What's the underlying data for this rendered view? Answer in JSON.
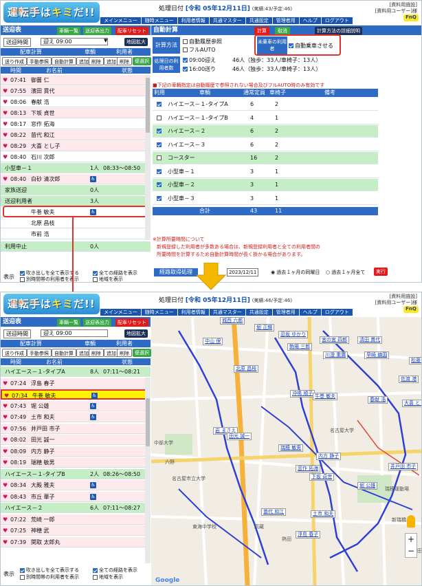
{
  "app": {
    "logo_small": "送迎表システム",
    "logo_text_a": "運転手は",
    "logo_text_b": "キミ",
    "logo_text_c": "だ!!",
    "logo_text_d": "クラウド",
    "org_line1": "[資料用施設]",
    "org_line2": "[資料用ユーザー]様",
    "fnq": "FnQ"
  },
  "menu": [
    "メインメニュー",
    "随時メニュー",
    "利用者情報",
    "共通マスター",
    "共通設定",
    "管理者用",
    "ヘルプ",
    "ログアウト"
  ],
  "shot1": {
    "date_label": "処理日付",
    "date_value": "[令和 05年12月11日]",
    "counts": "(実績:43/予定:46)",
    "panel_title": "送迎表",
    "btn_list": "車輌一覧",
    "btn_output": "送迎表出力",
    "btn_reset": "配車リセット",
    "time_label": "送迎時間",
    "time_value": "迎え 09:00",
    "map_btn": "地図拡大",
    "hdr_info": "配車計算",
    "hdr_car": "車輌",
    "hdr_user": "利用者",
    "btn_make": "送り作成",
    "btn_manual": "手動参照",
    "btn_auto": "自動計算",
    "btn_add": "追加",
    "btn_del": "削除",
    "btn_add2": "追加",
    "btn_del2": "削除",
    "btn_toilet": "便選択",
    "col_time": "時間",
    "col_name": "お名前",
    "col_status": "状態",
    "rows": [
      {
        "time": "07:41",
        "name": "御薗 仁"
      },
      {
        "time": "07:55",
        "name": "濱田 貫代"
      },
      {
        "time": "08:06",
        "name": "春献 浩"
      },
      {
        "time": "08:13",
        "name": "下坂 貞世"
      },
      {
        "time": "08:17",
        "name": "窓作 拓海"
      },
      {
        "time": "08:22",
        "name": "苗代 和江"
      },
      {
        "time": "08:29",
        "name": "大喜 とし子"
      },
      {
        "time": "08:40",
        "name": "石川 次郎"
      }
    ],
    "car_row": {
      "name": "小型車－１",
      "count": "1人",
      "time": "08:33〜08:50"
    },
    "car_row_user": {
      "time": "08:40",
      "name": "白砂 清次郎"
    },
    "family_row": {
      "name": "家族送迎",
      "count": "0人"
    },
    "users_row": {
      "name": "送迎利用者",
      "count": "3人"
    },
    "users": [
      "牛巻 敏夫",
      "北原 昌枝",
      "市前 浩"
    ],
    "stop_row": {
      "name": "利用中止",
      "count": "0人"
    },
    "display_label": "表示",
    "opt_blowout": "吹き出しを全て表示する",
    "opt_route": "全ての経路を表示",
    "opt_other": "別時間帯の利用者を表示",
    "opt_area": "地域を表示",
    "auto_title": "自動計算",
    "btn_calc": "計算",
    "btn_cancel": "取消",
    "btn_detail": "計算方法の詳細説明",
    "calc_method": "計算方法",
    "opt_history": "自動履歴参照",
    "opt_fullauto": "フルAUTO",
    "unassigned_label": "未乗車の利用者",
    "opt_autoboard": "自動乗車させる",
    "proc_day_label": "処理日の利用者数",
    "day_row1": {
      "label": "09:00迎え",
      "value": "46人（独歩：33人/車椅子：13人）"
    },
    "day_row2": {
      "label": "16:00送り",
      "value": "46人（独歩：33人/車椅子：13人）"
    },
    "note": "■下記の車輌指定は自動履歴で参照されない場合及びフルAUTO時のみ有効です",
    "tbl_use": "利用",
    "tbl_car": "車輌",
    "tbl_cap": "通常定員",
    "tbl_wheel": "車椅子",
    "tbl_note": "備考",
    "vehicles": [
      {
        "name": "ハイエース－１-タイプA",
        "cap": "6",
        "wheel": "2",
        "on": true,
        "green": false
      },
      {
        "name": "ハイエース－１-タイプB",
        "cap": "4",
        "wheel": "1",
        "on": false,
        "green": false
      },
      {
        "name": "ハイエース－２",
        "cap": "6",
        "wheel": "2",
        "on": true,
        "green": true
      },
      {
        "name": "ハイエース－３",
        "cap": "6",
        "wheel": "2",
        "on": true,
        "green": false
      },
      {
        "name": "コースター",
        "cap": "16",
        "wheel": "2",
        "on": false,
        "green": true
      },
      {
        "name": "小型車－１",
        "cap": "3",
        "wheel": "1",
        "on": true,
        "green": false
      },
      {
        "name": "小型車－２",
        "cap": "3",
        "wheel": "1",
        "on": true,
        "green": true
      },
      {
        "name": "小型車－３",
        "cap": "3",
        "wheel": "1",
        "on": true,
        "green": false
      }
    ],
    "total_label": "合計",
    "total_cap": "43",
    "total_wheel": "11",
    "warn1": "※計算所要時間について",
    "warn2": "新規登録した利用者が多数ある場合は、新規登録利用者と全ての利用者間の",
    "warn3": "所要時間を計算するため自動計算時間が長く掛かる場合があります。",
    "route_label": "経路取得処理",
    "route_date": "2023/12/11",
    "route_opt1": "過去１ヶ月の同曜日",
    "route_opt2": "過去１ヶ月全て",
    "btn_run": "実行"
  },
  "shot2": {
    "date_label": "処理日付",
    "date_value": "[令和 05年12月11日]",
    "counts": "(実績:46/予定:46)",
    "panel_title": "送迎表",
    "btn_list": "車輌一覧",
    "btn_output": "送迎表出力",
    "btn_reset": "配車リセット",
    "time_label": "送迎時間",
    "time_value": "迎え 09:00",
    "map_btn": "地図拡大",
    "car1": {
      "name": "ハイエース－１-タイプA",
      "count": "8人",
      "time": "07:11〜08:21"
    },
    "car1_rows": [
      {
        "time": "07:24",
        "name": "浮島 春子",
        "wc": false,
        "hl": false
      },
      {
        "time": "07:34",
        "name": "牛巻 敏夫",
        "wc": true,
        "hl": true
      },
      {
        "time": "07:43",
        "name": "堀 公雄",
        "wc": true,
        "hl": false
      },
      {
        "time": "07:49",
        "name": "土市 和夫",
        "wc": true,
        "hl": false
      },
      {
        "time": "07:56",
        "name": "井戸田 市子",
        "wc": false,
        "hl": false
      },
      {
        "time": "08:02",
        "name": "田光 誠一",
        "wc": false,
        "hl": false
      },
      {
        "time": "08:09",
        "name": "内方 静子",
        "wc": false,
        "hl": false
      },
      {
        "time": "08:19",
        "name": "瑞穂 敏男",
        "wc": false,
        "hl": false
      }
    ],
    "car2": {
      "name": "ハイエース－１-タイプB",
      "count": "2人",
      "time": "08:26〜08:50"
    },
    "car2_rows": [
      {
        "time": "08:34",
        "name": "大殿 雅夫",
        "wc": true
      },
      {
        "time": "08:43",
        "name": "市丘 華子",
        "wc": true
      }
    ],
    "car3": {
      "name": "ハイエース－２",
      "count": "6人",
      "time": "07:11〜08:27"
    },
    "car3_rows": [
      {
        "time": "07:22",
        "name": "荒崎 一郎",
        "wc": false
      },
      {
        "time": "07:25",
        "name": "神穂 武",
        "wc": false
      },
      {
        "time": "07:39",
        "name": "関取 太郎丸",
        "wc": false
      }
    ],
    "map_labels": [
      "城西 六郎",
      "堀 正輝",
      "忍坂 ゆかり",
      "宮の宮 四郎",
      "清田 貫代",
      "中山 保",
      "駒場 三郎",
      "川澄 重廣",
      "早崎 鎮国",
      "松藤 世之介",
      "北原 昌枝",
      "佐渡 港",
      "沖鳴 順子",
      "牛巻 敏夫",
      "春献 浩",
      "大喜 とし子",
      "岩 まさえ",
      "田光 誠一",
      "瑞穂 敏男",
      "内方 静子",
      "下坂 貞世",
      "窓作 拓海",
      "井戸田 市子",
      "堀 公雄",
      "苗代 和江",
      "土市 和夫",
      "浮島 春子"
    ],
    "map_places": [
      "中部大学",
      "六野",
      "名古屋市立大学",
      "東海中学校",
      "高蔵",
      "熱田",
      "堀田",
      "名古屋大学",
      "瑞穂運動場",
      "新瑞橋"
    ],
    "map_footer": "Google"
  }
}
